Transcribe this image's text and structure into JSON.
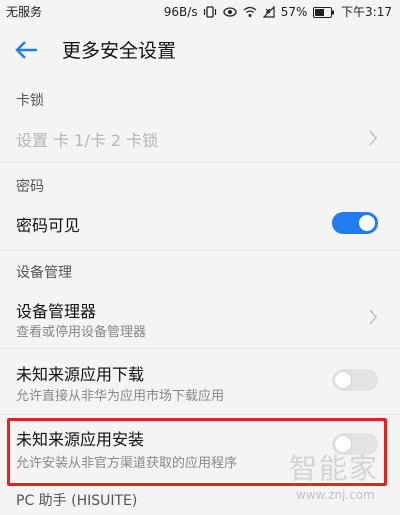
{
  "status_bar": {
    "carrier": "无服务",
    "net_speed": "96B/s",
    "battery": "57%",
    "time": "下午3:17"
  },
  "header": {
    "title": "更多安全设置"
  },
  "sections": {
    "sim_lock": {
      "header": "卡锁",
      "item_label": "设置 卡 1/卡 2 卡锁"
    },
    "password": {
      "header": "密码",
      "item_label": "密码可见",
      "toggle_on": true
    },
    "device_management": {
      "header": "设备管理",
      "device_admin_label": "设备管理器",
      "device_admin_sub": "查看或停用设备管理器",
      "unknown_download_label": "未知来源应用下载",
      "unknown_download_sub": "允许直接从非华为应用市场下载应用",
      "unknown_download_on": false,
      "unknown_install_label": "未知来源应用安装",
      "unknown_install_sub": "允许安装从非官方渠道获取的应用程序",
      "unknown_install_on": false
    },
    "pc_assistant": {
      "header": "PC 助手 (HISUITE)"
    }
  },
  "watermark": {
    "text": "智能家",
    "url": "www.znj.com"
  },
  "colors": {
    "accent": "#1f7df0",
    "highlight": "#e5221e"
  }
}
